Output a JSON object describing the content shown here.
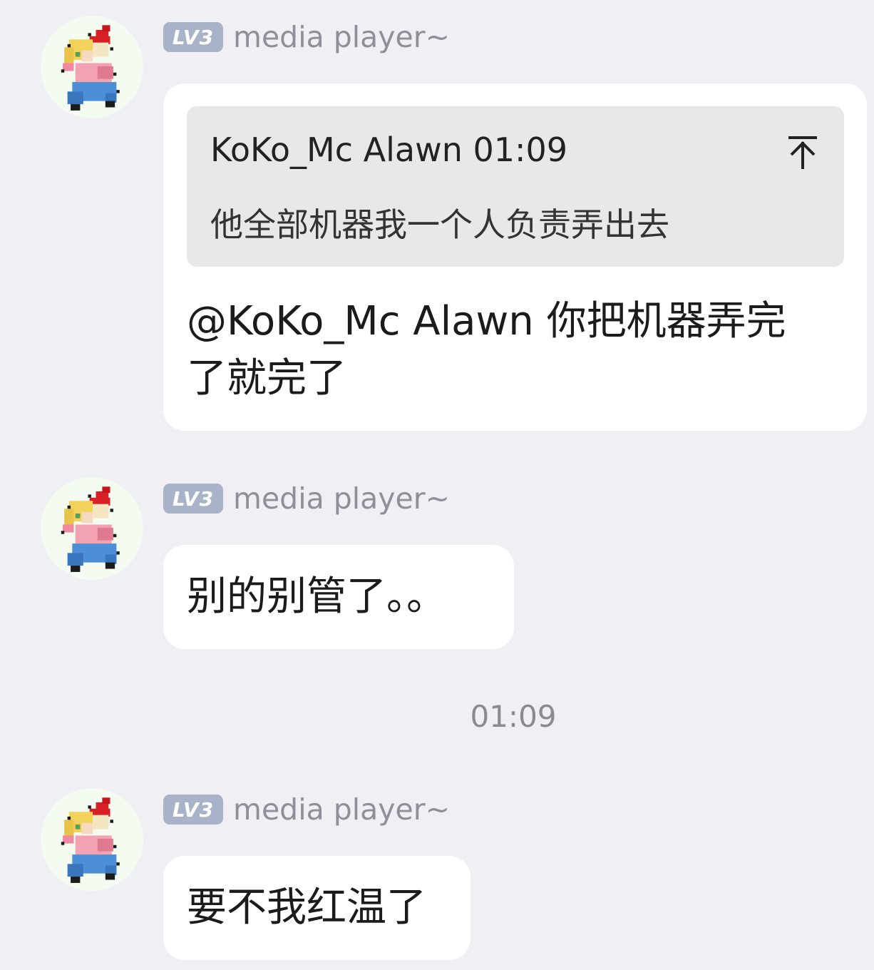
{
  "colors": {
    "background": "#efeff4",
    "bubble": "#ffffff",
    "quote_background": "#e8e8e8",
    "level_badge": "#a8b3c9",
    "sender_name": "#8f8f99",
    "timestamp": "#8a8a90"
  },
  "messages": [
    {
      "sender": {
        "level": "LV3",
        "name": "media player~"
      },
      "reply": {
        "header": "KoKo_Mc Alawn 01:09",
        "body": "他全部机器我一个人负责弄出去",
        "jump_icon": "arrow-up-to-top-icon"
      },
      "text_line1": "@KoKo_Mc Alawn 你把机器弄完",
      "text_line2": "了就完了"
    },
    {
      "sender": {
        "level": "LV3",
        "name": "media player~"
      },
      "text": "别的别管了。。"
    },
    {
      "time_divider": "01:09"
    },
    {
      "sender": {
        "level": "LV3",
        "name": "media player~"
      },
      "text": "要不我红温了"
    }
  ]
}
